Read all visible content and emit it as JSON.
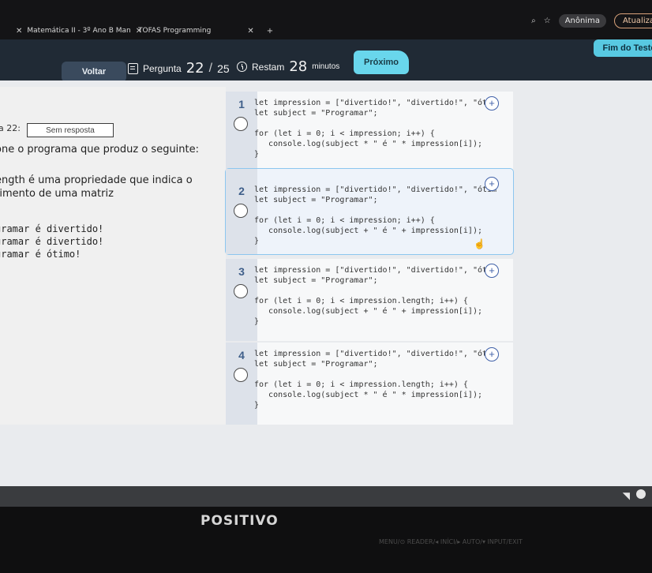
{
  "browser": {
    "tabs": [
      {
        "title": "Matemática II - 3º Ano B Man",
        "close": "✕"
      },
      {
        "title": "TOFAS Programming",
        "close": "✕"
      }
    ],
    "new_tab": "+",
    "profile": "Anônima",
    "update": "Atualiza"
  },
  "topbar": {
    "back_label": "Voltar",
    "question_label": "Pergunta",
    "question_current": "22",
    "question_sep": "/",
    "question_total": "25",
    "timer_label": "Restam",
    "timer_value": "28",
    "timer_unit": "minutos",
    "next_label": "Próximo",
    "finish_label": "Fim do Teste"
  },
  "question": {
    "number": "a 22:",
    "status": "Sem resposta",
    "prompt": "one o programa que produz o seguinte:",
    "hint_line1": "ength é uma propriedade que indica o",
    "hint_line2": "rimento de uma matriz",
    "output": "gramar é divertido!\ngramar é divertido!\ngramar é ótimo!"
  },
  "options": [
    {
      "num": "1",
      "code": "let impression = [\"divertido!\", \"divertido!\", \"ótim\nlet subject = \"Programar\";\n\nfor (let i = 0; i < impression; i++) {\n   console.log(subject * \" é \" * impression[i]);\n}"
    },
    {
      "num": "2",
      "code": "let impression = [\"divertido!\", \"divertido!\", \"ótim\nlet subject = \"Programar\";\n\nfor (let i = 0; i < impression; i++) {\n   console.log(subject + \" é \" + impression[i]);\n}"
    },
    {
      "num": "3",
      "code": "let impression = [\"divertido!\", \"divertido!\", \"ótim\nlet subject = \"Programar\";\n\nfor (let i = 0; i < impression.length; i++) {\n   console.log(subject + \" é \" + impression[i]);\n}"
    },
    {
      "num": "4",
      "code": "let impression = [\"divertido!\", \"divertido!\", \"ótim\nlet subject = \"Programar\";\n\nfor (let i = 0; i < impression.length; i++) {\n   console.log(subject * \" é \" * impression[i]);\n}"
    }
  ],
  "monitor": {
    "brand": "POSITIVO",
    "labels": "MENU/⊙   READER/◂   INÍCI/▸   AUTO/▾   INPUT/EXIT"
  },
  "icons": {
    "zoom": "+",
    "cursor": "☝",
    "wifi": "◥"
  }
}
